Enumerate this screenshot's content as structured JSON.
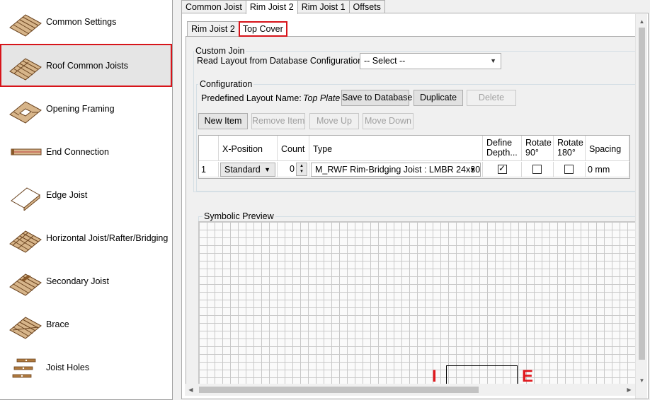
{
  "sidebar": {
    "items": [
      {
        "label": "Common Settings",
        "icon": "joist-panel-icon"
      },
      {
        "label": "Roof Common Joists",
        "icon": "roof-joists-icon",
        "selected": true
      },
      {
        "label": "Opening Framing",
        "icon": "opening-framing-icon"
      },
      {
        "label": "End Connection",
        "icon": "end-connection-icon"
      },
      {
        "label": "Edge Joist",
        "icon": "edge-joist-icon"
      },
      {
        "label": "Horizontal Joist/Rafter/Bridging",
        "icon": "horizontal-joist-icon"
      },
      {
        "label": "Secondary Joist",
        "icon": "secondary-joist-icon"
      },
      {
        "label": "Brace",
        "icon": "brace-icon"
      },
      {
        "label": "Joist Holes",
        "icon": "joist-holes-icon"
      }
    ]
  },
  "top_tabs": [
    "Common Joist",
    "Rim Joist 2",
    "Rim Joist 1",
    "Offsets"
  ],
  "sub_tabs": [
    "Rim Joist 2",
    "Top Cover"
  ],
  "custom_join": {
    "title": "Custom Join",
    "read_layout_label": "Read Layout from Database Configuration:",
    "read_layout_value": "-- Select --"
  },
  "configuration": {
    "title": "Configuration",
    "predefined_label": "Predefined Layout Name:",
    "predefined_value": "Top Plate",
    "save_label": "Save to Database",
    "duplicate_label": "Duplicate",
    "delete_label": "Delete"
  },
  "toolbar": {
    "new_item": "New Item",
    "remove_item": "Remove Item",
    "move_up": "Move Up",
    "move_down": "Move Down"
  },
  "table": {
    "headers": {
      "x_position": "X-Position",
      "count": "Count",
      "type": "Type",
      "define_depth_1": "Define",
      "define_depth_2": "Depth...",
      "rotate90_1": "Rotate",
      "rotate90_2": "90°",
      "rotate180_1": "Rotate",
      "rotate180_2": "180°",
      "spacing": "Spacing"
    },
    "rows": [
      {
        "num": "1",
        "x_position": "Standard",
        "count": "0",
        "type": "M_RWF Rim-Bridging Joist : LMBR 24x30",
        "define_depth": true,
        "rotate90": false,
        "rotate180": false,
        "spacing": "0 mm"
      }
    ]
  },
  "preview": {
    "title": "Symbolic Preview",
    "marker_left": "I",
    "marker_right": "E"
  },
  "colors": {
    "highlight": "#d7141a",
    "wood": "#b07a3e"
  }
}
